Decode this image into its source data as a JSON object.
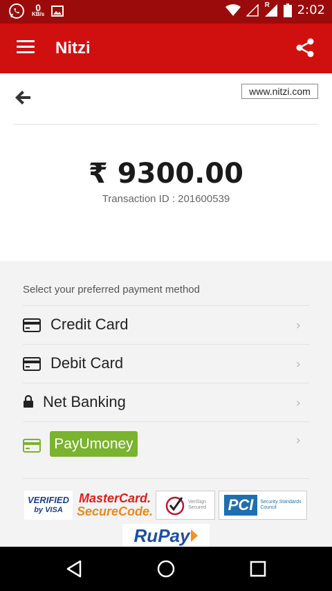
{
  "status_bar": {
    "kbs_value": "0",
    "kbs_unit": "KB/s",
    "carrier_mark": "R",
    "time": "2:02"
  },
  "app_bar": {
    "title": "Nitzi"
  },
  "header": {
    "site_link": "www.nitzi.com"
  },
  "payment": {
    "amount": "₹ 9300.00",
    "transaction": "Transaction ID : 201600539"
  },
  "methods": {
    "heading": "Select your preferred payment method",
    "items": [
      {
        "label": "Credit Card",
        "icon": "credit-card-icon"
      },
      {
        "label": "Debit Card",
        "icon": "debit-card-icon"
      },
      {
        "label": "Net Banking",
        "icon": "lock-icon"
      },
      {
        "label": "PayUmoney",
        "icon": "wallet-icon"
      }
    ]
  },
  "badges": {
    "visa_line1": "VERIFIED",
    "visa_line2": "by VISA",
    "mastercard_line1": "MasterCard.",
    "mastercard_line2": "SecureCode.",
    "verisign_line1": "VeriSign",
    "verisign_line2": "Secured",
    "pci_logo": "PCI",
    "pci_text": "Security Standards Council",
    "rupay": "RuPay"
  },
  "colors": {
    "status_bar": "#9c0b0b",
    "app_bar": "#d0100f",
    "payu_green": "#7ab32e",
    "panel_bg": "#f3f3f3"
  }
}
